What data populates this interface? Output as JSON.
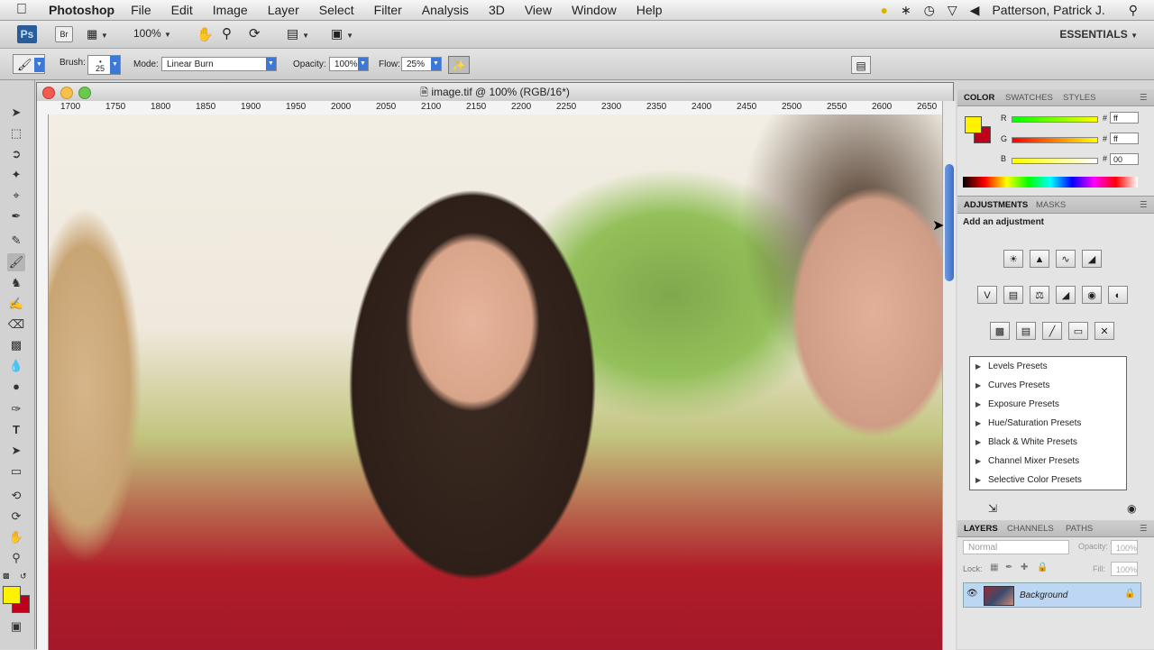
{
  "menubar": {
    "app_name": "Photoshop",
    "items": [
      "File",
      "Edit",
      "Image",
      "Layer",
      "Select",
      "Filter",
      "Analysis",
      "3D",
      "View",
      "Window",
      "Help"
    ],
    "user": "Patterson, Patrick J."
  },
  "appbar": {
    "logo": "Ps",
    "br_label": "Br",
    "zoom": "100%",
    "workspace": "ESSENTIALS"
  },
  "options": {
    "brush_label": "Brush:",
    "brush_size": "25",
    "mode_label": "Mode:",
    "mode_value": "Linear Burn",
    "opacity_label": "Opacity:",
    "opacity_value": "100%",
    "flow_label": "Flow:",
    "flow_value": "25%"
  },
  "document": {
    "title": "image.tif @ 100% (RGB/16*)",
    "ruler_ticks": [
      "1700",
      "1750",
      "1800",
      "1850",
      "1900",
      "1950",
      "2000",
      "2050",
      "2100",
      "2150",
      "2200",
      "2250",
      "2300",
      "2350",
      "2400",
      "2450",
      "2500",
      "2550",
      "2600",
      "2650"
    ]
  },
  "color_panel": {
    "tabs": [
      "COLOR",
      "SWATCHES",
      "STYLES"
    ],
    "r_label": "R",
    "g_label": "G",
    "b_label": "B",
    "r_hex": "ff",
    "g_hex": "ff",
    "b_hex": "00",
    "foreground": "#fff200",
    "background": "#c0001a"
  },
  "adjustments_panel": {
    "tabs": [
      "ADJUSTMENTS",
      "MASKS"
    ],
    "heading": "Add an adjustment",
    "presets": [
      "Levels Presets",
      "Curves Presets",
      "Exposure Presets",
      "Hue/Saturation Presets",
      "Black & White Presets",
      "Channel Mixer Presets",
      "Selective Color Presets"
    ]
  },
  "layers_panel": {
    "tabs": [
      "LAYERS",
      "CHANNELS",
      "PATHS"
    ],
    "blend_mode": "Normal",
    "opacity_label": "Opacity:",
    "opacity_value": "100%",
    "lock_label": "Lock:",
    "fill_label": "Fill:",
    "fill_value": "100%",
    "layer_name": "Background"
  }
}
